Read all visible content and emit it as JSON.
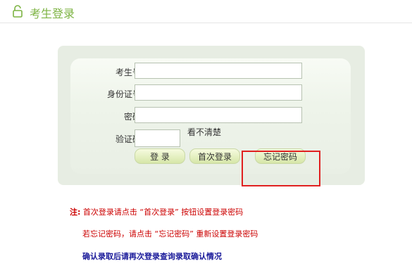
{
  "header": {
    "title": "考生登录",
    "icon": "lock-icon"
  },
  "form": {
    "candidate_label": "考生号:",
    "id_label": "身份证号:",
    "password_label": "密码:",
    "captcha_label": "验证码:",
    "captcha_hint": "看不清楚",
    "candidate_value": "",
    "id_value": "",
    "password_value": "",
    "captcha_value": ""
  },
  "buttons": {
    "login": "登 录",
    "first_login": "首次登录",
    "forgot_password": "忘记密码"
  },
  "notes": {
    "prefix": "注:",
    "line1": "首次登录请点击 “首次登录” 按钮设置登录密码",
    "line2": "若忘记密码，请点击 “忘记密码” 重新设置登录密码",
    "line3": "确认录取后请再次登录查询录取确认情况"
  },
  "colors": {
    "title": "#7cb342",
    "note_red": "#cc0000",
    "note_blue": "#1a1a9a",
    "highlight_box": "#e02020"
  }
}
